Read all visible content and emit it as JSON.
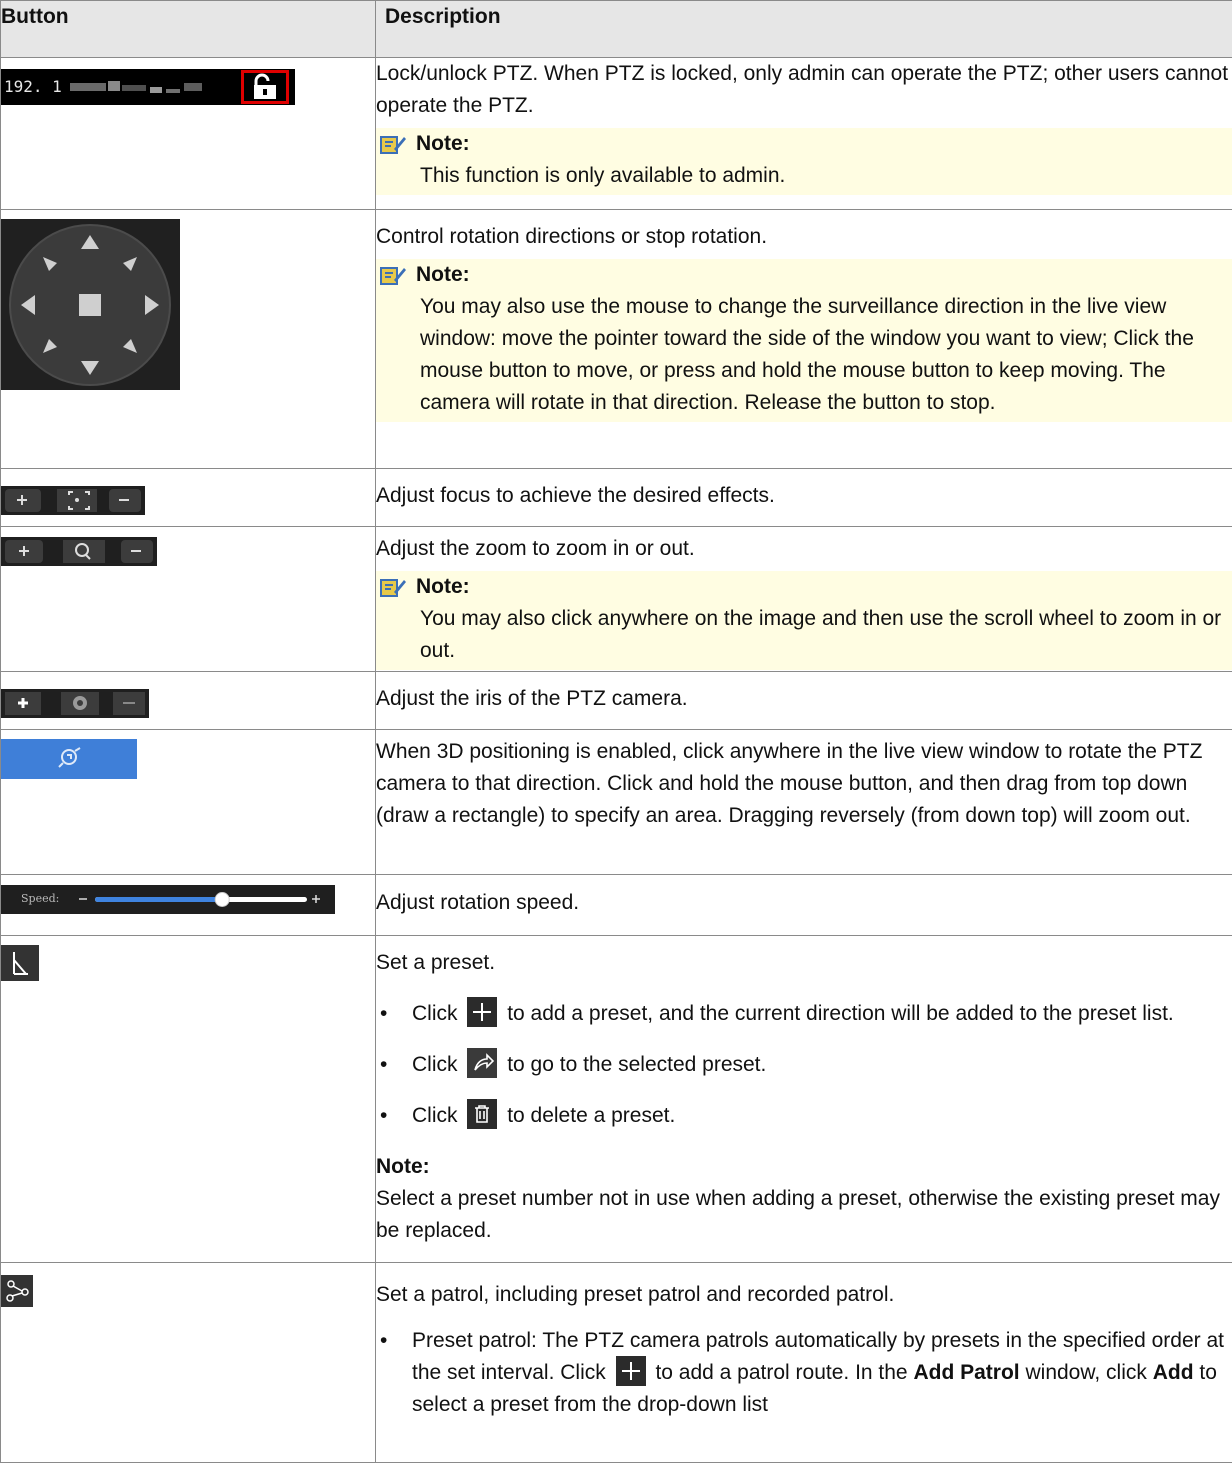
{
  "header": {
    "col_button": "Button",
    "col_description": "Description"
  },
  "rows": {
    "lock": {
      "image_text": "192. 1",
      "text": "Lock/unlock PTZ. When PTZ is locked, only admin can operate the PTZ; other users cannot operate the PTZ.",
      "note_label": "Note:",
      "note_text": "This function is only available to admin."
    },
    "direction": {
      "text": "Control rotation directions or stop rotation.",
      "note_label": "Note:",
      "note_text": "You may also use the mouse to change the surveillance direction in the live view window: move the pointer toward the side of the window you want to view; Click the mouse button to move, or press and hold the mouse button to keep moving. The camera will rotate in that direction. Release the button to stop."
    },
    "focus": {
      "text": "Adjust focus to achieve the desired effects."
    },
    "zoom": {
      "text": "Adjust the zoom to zoom in or out.",
      "note_label": "Note:",
      "note_text": "You may also click anywhere on the image and then use the scroll wheel to zoom in or out."
    },
    "iris": {
      "text": "Adjust the iris of the PTZ camera."
    },
    "positioning": {
      "text": "When 3D positioning is enabled, click anywhere in the live view window to rotate the PTZ camera to that direction. Click and hold the mouse button, and then drag from top down (draw a rectangle) to specify an area. Dragging reversely (from down top) will zoom out."
    },
    "speed": {
      "image_label": "Speed:",
      "slider_value": 0.6,
      "text": "Adjust rotation speed."
    },
    "preset": {
      "text": "Set a preset.",
      "bullet1_a": "Click",
      "bullet1_b": "to add a preset, and the current direction will be added to the preset list.",
      "bullet2_a": "Click",
      "bullet2_b": "to go to the selected preset.",
      "bullet3_a": "Click",
      "bullet3_b": "to delete a preset.",
      "note_label": "Note:",
      "note_text": "Select a preset number not in use when adding a preset, otherwise the existing preset may be replaced."
    },
    "patrol": {
      "text": "Set a patrol, including preset patrol and recorded patrol.",
      "bullet_a": "Preset patrol: The PTZ camera patrols automatically by presets in the specified order at the set interval. Click",
      "bullet_b": "to add a patrol route. In the",
      "bold_add_patrol": "Add Patrol",
      "bullet_c": "window, click",
      "bold_add": "Add",
      "bullet_d": "to select a preset from the drop-down list"
    }
  },
  "icons": {
    "note": "note-pencil-icon",
    "plus": "plus-icon",
    "goto": "goto-arrow-icon",
    "delete": "trash-icon"
  }
}
